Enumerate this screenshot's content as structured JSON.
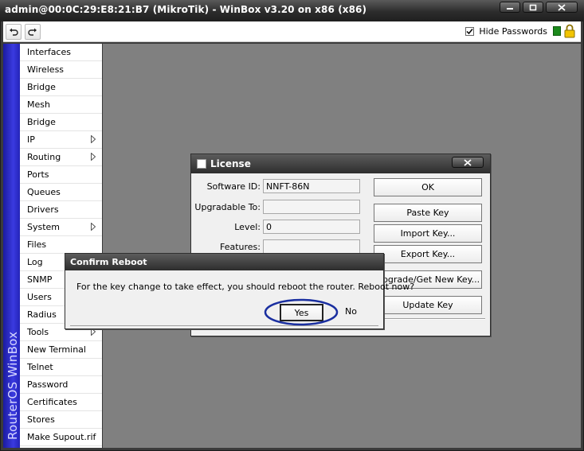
{
  "window": {
    "title": "admin@00:0C:29:E8:21:B7 (MikroTik) - WinBox v3.20 on x86 (x86)"
  },
  "toolbar": {
    "undo_icon": "undo-icon",
    "redo_icon": "redo-icon",
    "hide_passwords_label": "Hide Passwords",
    "hide_passwords_checked": true
  },
  "sidebar": {
    "brand": "RouterOS WinBox",
    "items": [
      {
        "label": "Interfaces",
        "submenu": false
      },
      {
        "label": "Wireless",
        "submenu": false
      },
      {
        "label": "Bridge",
        "submenu": false
      },
      {
        "label": "Mesh",
        "submenu": false
      },
      {
        "label": "Bridge",
        "submenu": false
      },
      {
        "label": "IP",
        "submenu": true
      },
      {
        "label": "Routing",
        "submenu": true
      },
      {
        "label": "Ports",
        "submenu": false
      },
      {
        "label": "Queues",
        "submenu": false
      },
      {
        "label": "Drivers",
        "submenu": false
      },
      {
        "label": "System",
        "submenu": true
      },
      {
        "label": "Files",
        "submenu": false
      },
      {
        "label": "Log",
        "submenu": false
      },
      {
        "label": "SNMP",
        "submenu": false
      },
      {
        "label": "Users",
        "submenu": false
      },
      {
        "label": "Radius",
        "submenu": false
      },
      {
        "label": "Tools",
        "submenu": true
      },
      {
        "label": "New Terminal",
        "submenu": false
      },
      {
        "label": "Telnet",
        "submenu": false
      },
      {
        "label": "Password",
        "submenu": false
      },
      {
        "label": "Certificates",
        "submenu": false
      },
      {
        "label": "Stores",
        "submenu": false
      },
      {
        "label": "Make Supout.rif",
        "submenu": false
      }
    ]
  },
  "license": {
    "title": "License",
    "fields": [
      {
        "label": "Software ID:",
        "value": "NNFT-86N"
      },
      {
        "label": "Upgradable To:",
        "value": ""
      },
      {
        "label": "Level:",
        "value": "0"
      },
      {
        "label": "Features:",
        "value": ""
      }
    ],
    "buttons": [
      "OK",
      "Paste Key",
      "Import Key...",
      "Export Key...",
      "Upgrade/Get New Key...",
      "Update Key"
    ]
  },
  "confirm": {
    "title": "Confirm Reboot",
    "message": "For the key change to take effect, you should reboot the router. Reboot now?",
    "yes_label": "Yes",
    "no_label": "No"
  },
  "colors": {
    "titlebar": "#2c2c2c",
    "sidebar_strip": "#2a2ac8",
    "workspace": "#808080",
    "highlight": "#1a2fa0"
  }
}
